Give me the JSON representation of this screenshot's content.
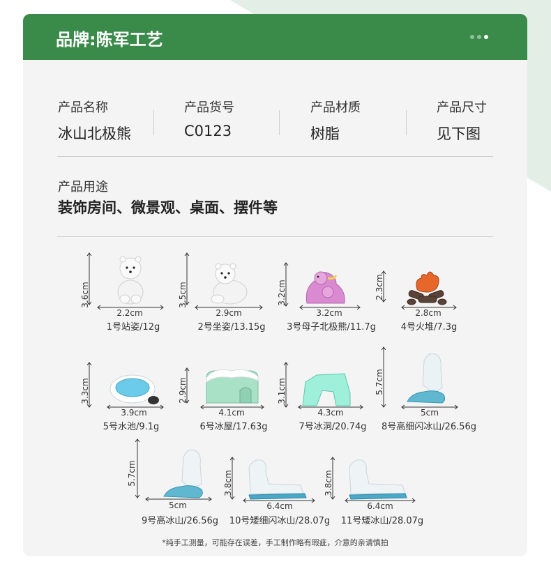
{
  "brand": "品牌:陈军工艺",
  "pager": {
    "count": 3,
    "active": 2
  },
  "specs": [
    {
      "label": "产品名称",
      "value": "冰山北极熊"
    },
    {
      "label": "产品货号",
      "value": "C0123"
    },
    {
      "label": "产品材质",
      "value": "树脂"
    },
    {
      "label": "产品尺寸",
      "value": "见下图"
    }
  ],
  "usage": {
    "label": "产品用途",
    "value": "装饰房间、微景观、桌面、摆件等"
  },
  "items": [
    {
      "height": "3.6cm",
      "width": "2.2cm",
      "caption": "1号站姿/12g"
    },
    {
      "height": "3.5cm",
      "width": "2.9cm",
      "caption": "2号坐姿/13.15g"
    },
    {
      "height": "3.2cm",
      "width": "3.2cm",
      "caption": "3号母子北极熊/11.7g"
    },
    {
      "height": "2.3cm",
      "width": "2.8cm",
      "caption": "4号火堆/7.3g"
    },
    {
      "height": "3.3cm",
      "width": "3.9cm",
      "caption": "5号水池/9.1g"
    },
    {
      "height": "2.9cm",
      "width": "4.1cm",
      "caption": "6号冰屋/17.63g"
    },
    {
      "height": "3.1cm",
      "width": "4.3cm",
      "caption": "7号冰洞/20.74g"
    },
    {
      "height": "5.7cm",
      "width": "5cm",
      "caption": "8号高细闪冰山/26.56g"
    },
    {
      "height": "5.7cm",
      "width": "5cm",
      "caption": "9号高冰山/26.56g"
    },
    {
      "height": "3.8cm",
      "width": "6.4cm",
      "caption": "10号矮细闪冰山/28.07g"
    },
    {
      "height": "3.8cm",
      "width": "6.4cm",
      "caption": "11号矮冰山/28.07g"
    }
  ],
  "note": "*纯手工测量，可能存在误差，手工制作略有瑕疵，介意的亲请慎拍",
  "colors": {
    "header": "#3a8a4a",
    "card": "#f4f4f4",
    "accent_bg": "#e3eee6"
  }
}
